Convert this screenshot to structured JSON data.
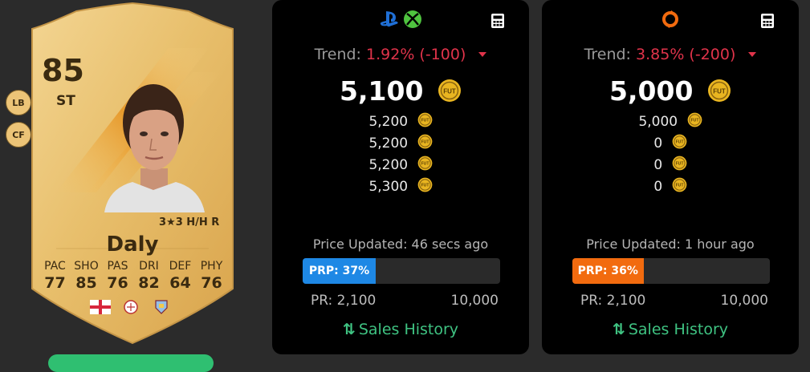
{
  "card": {
    "rating": "85",
    "position": "ST",
    "alt_positions": [
      "LB",
      "CF"
    ],
    "skills": "3★3 H/H R",
    "name": "Daly",
    "stats": [
      {
        "label": "PAC",
        "value": "77"
      },
      {
        "label": "SHO",
        "value": "85"
      },
      {
        "label": "PAS",
        "value": "76"
      },
      {
        "label": "DRI",
        "value": "82"
      },
      {
        "label": "DEF",
        "value": "64"
      },
      {
        "label": "PHY",
        "value": "76"
      }
    ],
    "badge_icons": [
      "england-flag-icon",
      "league-badge-icon",
      "club-badge-icon"
    ]
  },
  "panels": [
    {
      "platform_icons": [
        "playstation-icon",
        "xbox-icon"
      ],
      "trend_label": "Trend:",
      "trend_value": "1.92% (-100)",
      "price": "5,100",
      "recent_prices": [
        "5,200",
        "5,200",
        "5,200",
        "5,300"
      ],
      "updated": "Price Updated: 46 secs ago",
      "prp_label": "PRP: 37%",
      "prp_percent": 37,
      "prp_color": "#1e88e5",
      "range_low": "PR: 2,100",
      "range_high": "10,000",
      "sales_history": "Sales History"
    },
    {
      "platform_icons": [
        "origin-icon"
      ],
      "trend_label": "Trend:",
      "trend_value": "3.85% (-200)",
      "price": "5,000",
      "recent_prices": [
        "5,000",
        "0",
        "0",
        "0"
      ],
      "updated": "Price Updated: 1 hour ago",
      "prp_label": "PRP: 36%",
      "prp_percent": 36,
      "prp_color": "#f26b0f",
      "range_low": "PR: 2,100",
      "range_high": "10,000",
      "sales_history": "Sales History"
    }
  ],
  "colors": {
    "trend_down": "#e0334a",
    "coin_gold": "#e9b520",
    "sales_green": "#3fc382"
  }
}
